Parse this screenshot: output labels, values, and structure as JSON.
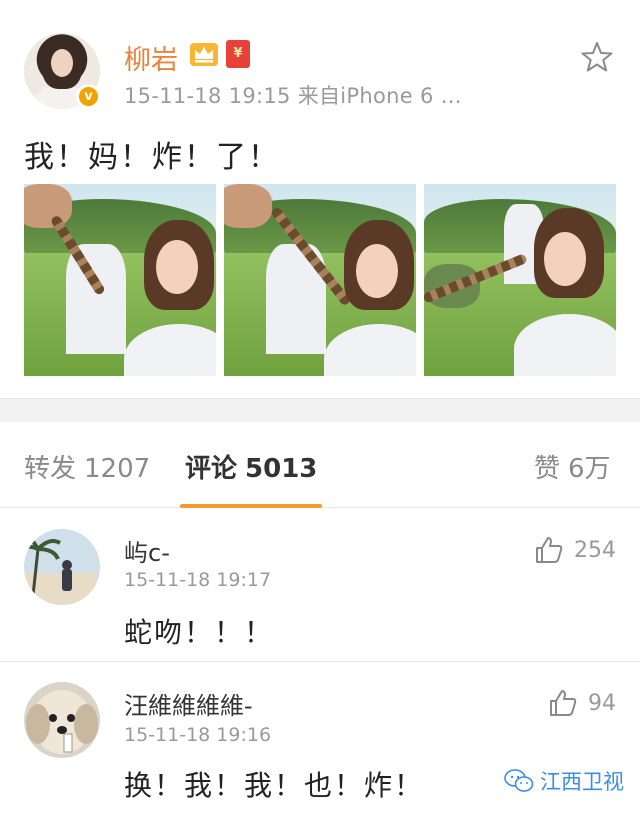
{
  "post": {
    "author": "柳岩",
    "badge_text": "¥",
    "meta": "15-11-18 19:15  来自iPhone 6 …",
    "verified_mark": "v",
    "text": "我！妈！炸！了！",
    "photo_count": 3
  },
  "tabs": [
    {
      "label": "转发",
      "count": "1207"
    },
    {
      "label": "评论",
      "count": "5013"
    },
    {
      "label": "赞",
      "count": "6万"
    }
  ],
  "comments": [
    {
      "name": "屿c-",
      "time": "15-11-18 19:17",
      "text": "蛇吻！！！",
      "likes": "254"
    },
    {
      "name": "汪維維維維-",
      "time": "15-11-18 19:16",
      "text": "换！我！我！也！炸！",
      "likes": "94"
    }
  ],
  "watermark": {
    "text": "江西卫视"
  },
  "colors": {
    "author": "#e8823d",
    "accent_tab": "#f29b2b",
    "verified": "#f4a200",
    "watermark": "#3b8ee8"
  },
  "icons": [
    "star-icon",
    "crown-icon",
    "red-packet-icon",
    "verified-icon",
    "thumbs-up-icon",
    "wechat-icon"
  ]
}
